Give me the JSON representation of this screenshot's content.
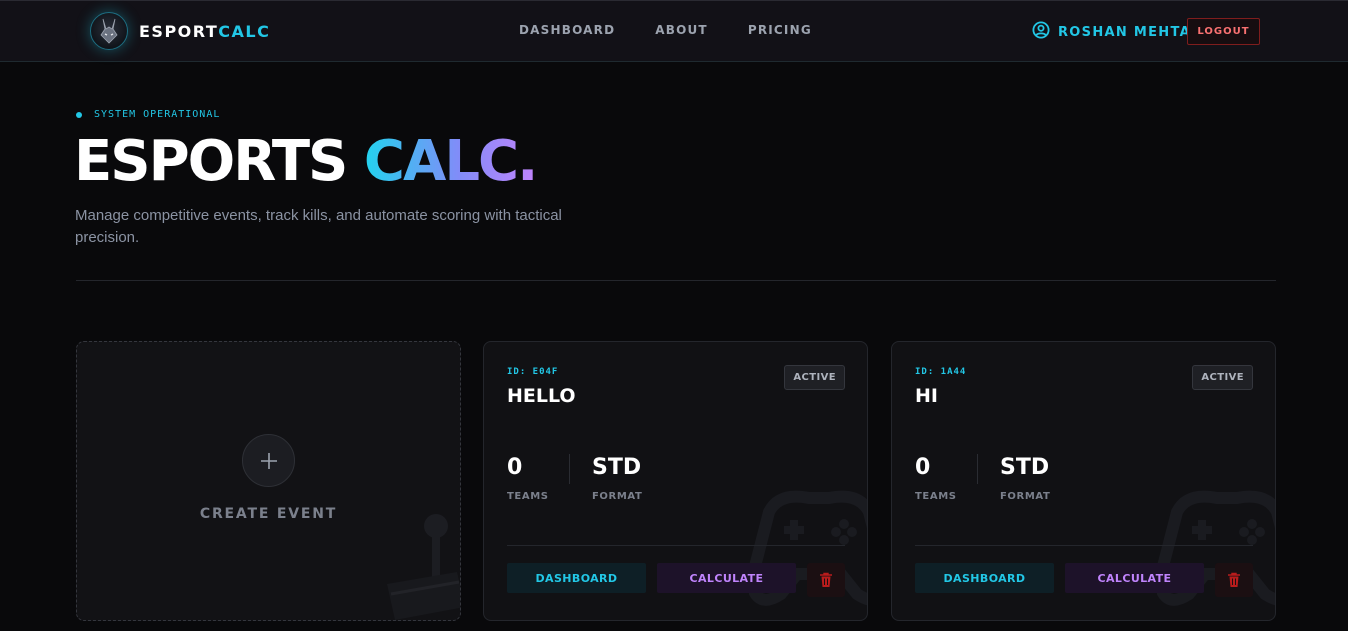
{
  "nav": {
    "brand_a": "ESPORT",
    "brand_b": "CALC",
    "links": [
      "DASHBOARD",
      "ABOUT",
      "PRICING"
    ],
    "user_name": "ROSHAN MEHTA",
    "logout_label": "LOGOUT",
    "logo_icon": "bunny-mask-logo",
    "user_icon": "user-circle-icon"
  },
  "hero": {
    "status_text": "SYSTEM OPERATIONAL",
    "title_a": "ESPORTS ",
    "title_b": "CALC.",
    "subtitle": "Manage competitive events, track kills, and automate scoring with tactical precision."
  },
  "create": {
    "label": "CREATE EVENT",
    "icon": "plus-icon",
    "decor_icon": "joystick-icon"
  },
  "events": [
    {
      "id": "ID: E04F",
      "name": "HELLO",
      "status": "ACTIVE",
      "teams": "0",
      "teams_label": "TEAMS",
      "format": "STD",
      "format_label": "FORMAT",
      "dashboard_label": "DASHBOARD",
      "calculate_label": "CALCULATE"
    },
    {
      "id": "ID: 1A44",
      "name": "HI",
      "status": "ACTIVE",
      "teams": "0",
      "teams_label": "TEAMS",
      "format": "STD",
      "format_label": "FORMAT",
      "dashboard_label": "DASHBOARD",
      "calculate_label": "CALCULATE"
    }
  ],
  "colors": {
    "accent_cyan": "#22c7e6",
    "accent_purple": "#c084fc",
    "danger": "#f87171",
    "background": "#09090b"
  }
}
